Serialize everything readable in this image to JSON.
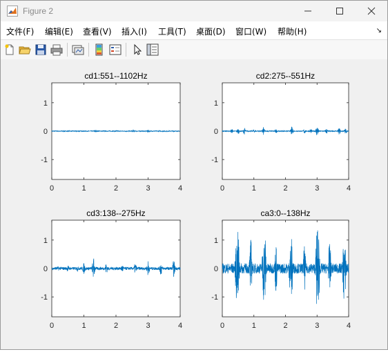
{
  "window": {
    "title": "Figure 2"
  },
  "menu": {
    "items": [
      "文件(F)",
      "编辑(E)",
      "查看(V)",
      "插入(I)",
      "工具(T)",
      "桌面(D)",
      "窗口(W)",
      "帮助(H)"
    ],
    "overflow_arrow": "↘"
  },
  "toolbar": {
    "icons": [
      "new-figure-icon",
      "open-file-icon",
      "save-icon",
      "print-icon",
      "link-plot-icon",
      "insert-colorbar-icon",
      "insert-legend-icon",
      "edit-plot-icon",
      "property-inspector-icon"
    ]
  },
  "colors": {
    "line": "#0072BD",
    "axes_bg": "#ffffff",
    "figure_bg": "#f0f0f0"
  },
  "chart_data": [
    {
      "type": "line",
      "title": "cd1:551--1102Hz",
      "xlim": [
        0,
        4
      ],
      "ylim": [
        -1.7,
        1.7
      ],
      "xticks": [
        "0",
        "1",
        "2",
        "3",
        "4"
      ],
      "yticks": [
        "1",
        "0",
        "-1"
      ],
      "series": [
        {
          "values": [
            [
              0.0,
              0.0
            ],
            [
              0.7,
              0.01
            ],
            [
              1.0,
              0.02
            ],
            [
              1.35,
              0.06
            ],
            [
              1.7,
              0.01
            ],
            [
              2.0,
              0.03
            ],
            [
              2.3,
              0.02
            ],
            [
              2.55,
              0.05
            ],
            [
              3.0,
              0.05
            ],
            [
              3.35,
              0.01
            ],
            [
              3.6,
              0.02
            ],
            [
              3.9,
              0.02
            ],
            [
              4.0,
              0.0
            ]
          ]
        }
      ]
    },
    {
      "type": "line",
      "title": "cd2:275--551Hz",
      "xlim": [
        0,
        4
      ],
      "ylim": [
        -1.7,
        1.7
      ],
      "xticks": [
        "0",
        "1",
        "2",
        "3",
        "4"
      ],
      "yticks": [
        "1",
        "0",
        "-1"
      ],
      "series": [
        {
          "values": [
            [
              0.0,
              0.0
            ],
            [
              0.3,
              0.08
            ],
            [
              0.5,
              -0.1
            ],
            [
              0.7,
              0.12
            ],
            [
              1.0,
              0.06
            ],
            [
              1.3,
              0.15
            ],
            [
              1.7,
              0.07
            ],
            [
              2.2,
              0.15
            ],
            [
              2.6,
              0.1
            ],
            [
              2.8,
              0.08
            ],
            [
              3.0,
              0.2
            ],
            [
              3.3,
              0.1
            ],
            [
              3.7,
              0.12
            ],
            [
              3.9,
              0.1
            ],
            [
              4.0,
              0.0
            ]
          ]
        }
      ]
    },
    {
      "type": "line",
      "title": "cd3:138--275Hz",
      "xlim": [
        0,
        4
      ],
      "ylim": [
        -1.7,
        1.7
      ],
      "xticks": [
        "0",
        "1",
        "2",
        "3",
        "4"
      ],
      "yticks": [
        "1",
        "0",
        "-1"
      ],
      "series": [
        {
          "values": [
            [
              0.0,
              0.0
            ],
            [
              0.2,
              0.08
            ],
            [
              0.5,
              0.12
            ],
            [
              0.8,
              0.1
            ],
            [
              1.0,
              0.2
            ],
            [
              1.3,
              -0.4
            ],
            [
              1.7,
              0.2
            ],
            [
              2.2,
              0.15
            ],
            [
              2.6,
              0.2
            ],
            [
              3.0,
              0.3
            ],
            [
              3.4,
              0.25
            ],
            [
              3.8,
              -0.3
            ],
            [
              4.0,
              0.0
            ]
          ]
        }
      ]
    },
    {
      "type": "line",
      "title": "ca3:0--138Hz",
      "xlim": [
        0,
        4
      ],
      "ylim": [
        -1.7,
        1.7
      ],
      "xticks": [
        "0",
        "1",
        "2",
        "3",
        "4"
      ],
      "yticks": [
        "1",
        "0",
        "-1"
      ],
      "series": [
        {
          "values": [
            [
              0.0,
              0.1
            ],
            [
              0.45,
              1.2
            ],
            [
              0.5,
              -1.4
            ],
            [
              0.9,
              1.1
            ],
            [
              1.3,
              1.2
            ],
            [
              1.35,
              -1.3
            ],
            [
              1.7,
              0.9
            ],
            [
              2.15,
              0.9
            ],
            [
              2.2,
              -1.1
            ],
            [
              2.6,
              0.8
            ],
            [
              3.05,
              1.3
            ],
            [
              3.0,
              -1.7
            ],
            [
              3.4,
              1.0
            ],
            [
              3.85,
              1.2
            ],
            [
              3.9,
              -0.8
            ],
            [
              4.0,
              0.0
            ]
          ]
        }
      ]
    }
  ]
}
